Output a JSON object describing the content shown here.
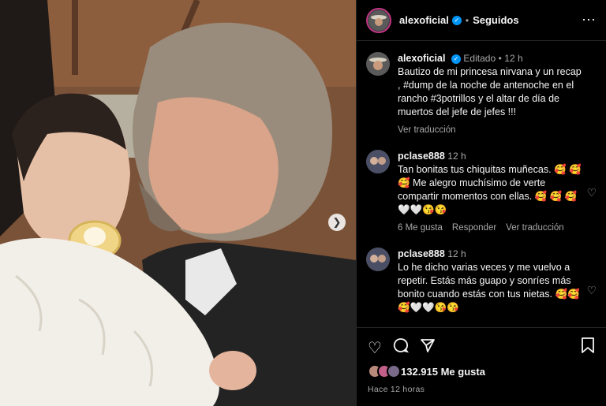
{
  "header": {
    "username": "alexoficial",
    "separator": "•",
    "follow_status": "Seguidos",
    "more_icon": "⋯"
  },
  "caption": {
    "username": "alexoficial",
    "edited": "Editado",
    "separator": "•",
    "time": "12 h",
    "text": "Bautizo de mi princesa nirvana y un recap , #dump de la noche de antenoche en el rancho #3potrillos y el altar de día de muertos del jefe de jefes !!!",
    "translate": "Ver traducción"
  },
  "comments": [
    {
      "username": "pclase888",
      "time": "12 h",
      "text": "Tan bonitas tus chiquitas muñecas. 🥰 🥰 🥰 Me alegro muchísimo de verte compartir momentos con ellas. 🥰 🥰 🥰🤍🤍😘😘",
      "likes": "6 Me gusta",
      "reply": "Responder",
      "translate": "Ver traducción"
    },
    {
      "username": "pclase888",
      "time": "12 h",
      "text": "Lo he dicho varias veces y me vuelvo a repetir. Estás más guapo y sonríes más bonito cuando estás con tus nietas. 🥰🥰🥰🤍🤍😘😘",
      "likes": "",
      "reply": "",
      "translate": ""
    }
  ],
  "footer": {
    "likes_count": "132.915 Me gusta",
    "time_ago": "Hace 12 horas"
  },
  "icons": {
    "like": "heart-icon",
    "comment": "comment-icon",
    "share": "share-icon",
    "save": "bookmark-icon",
    "next": "chevron-right-icon"
  },
  "colors": {
    "verified": "#0095f6",
    "background": "#000000",
    "muted": "#a8a8a8"
  }
}
